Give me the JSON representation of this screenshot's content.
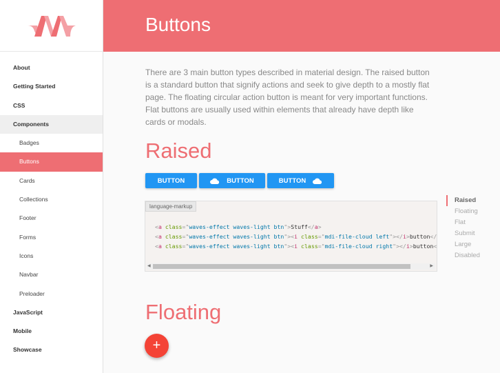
{
  "sidebar": {
    "items": [
      {
        "label": "About",
        "type": "top"
      },
      {
        "label": "Getting Started",
        "type": "top"
      },
      {
        "label": "CSS",
        "type": "top"
      },
      {
        "label": "Components",
        "type": "group"
      },
      {
        "label": "Badges",
        "type": "sub"
      },
      {
        "label": "Buttons",
        "type": "active"
      },
      {
        "label": "Cards",
        "type": "sub"
      },
      {
        "label": "Collections",
        "type": "sub"
      },
      {
        "label": "Footer",
        "type": "sub"
      },
      {
        "label": "Forms",
        "type": "sub"
      },
      {
        "label": "Icons",
        "type": "sub"
      },
      {
        "label": "Navbar",
        "type": "sub"
      },
      {
        "label": "Preloader",
        "type": "sub"
      },
      {
        "label": "JavaScript",
        "type": "top"
      },
      {
        "label": "Mobile",
        "type": "top"
      },
      {
        "label": "Showcase",
        "type": "top"
      }
    ]
  },
  "header": {
    "title": "Buttons"
  },
  "intro": "There are 3 main button types described in material design. The raised button is a standard button that signify actions and seek to give depth to a mostly flat page. The floating circular action button is meant for very important functions. Flat buttons are usually used within elements that already have depth like cards or modals.",
  "sections": {
    "raised": "Raised",
    "floating": "Floating"
  },
  "buttons": {
    "b1": "BUTTON",
    "b2": "BUTTON",
    "b3": "BUTTON"
  },
  "code": {
    "lang": "language-markup"
  },
  "toc": [
    "Raised",
    "Floating",
    "Flat",
    "Submit",
    "Large",
    "Disabled"
  ],
  "fab": "+",
  "colors": {
    "primary": "#ee6e73",
    "button": "#2196f3",
    "fab": "#f44336"
  }
}
